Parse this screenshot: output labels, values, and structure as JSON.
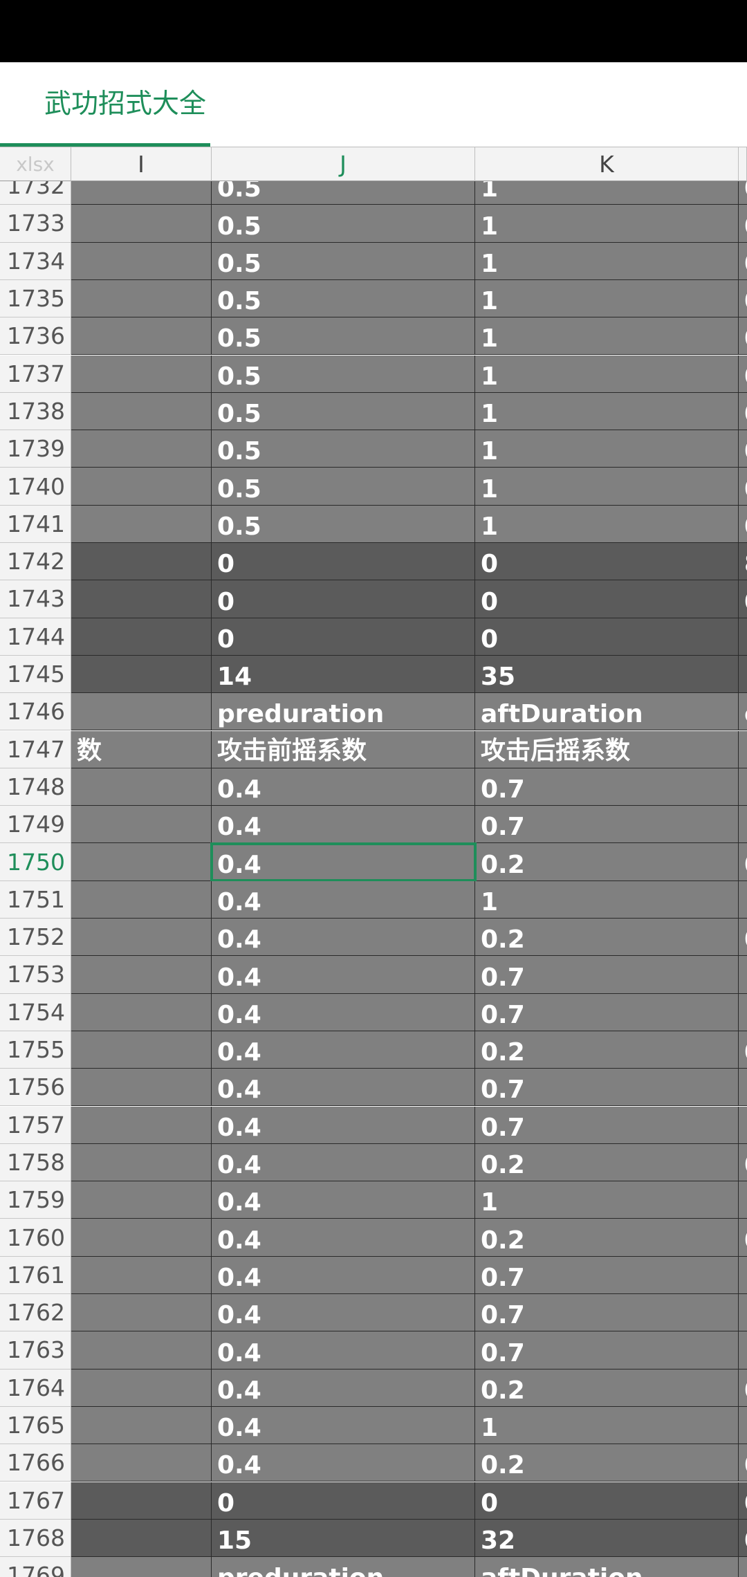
{
  "sheet_tab": {
    "label": "武功招式大全"
  },
  "columns": [
    {
      "label": "xlsx"
    },
    {
      "label": "I"
    },
    {
      "label": "J"
    },
    {
      "label": "K"
    },
    {
      "label": ""
    }
  ],
  "selected": {
    "row": "1750",
    "column": "J"
  },
  "rows": [
    {
      "num": "1732",
      "i": "",
      "j": "0.5",
      "k": "1",
      "l": "0",
      "style": "light"
    },
    {
      "num": "1733",
      "i": "",
      "j": "0.5",
      "k": "1",
      "l": "0",
      "style": "light"
    },
    {
      "num": "1734",
      "i": "",
      "j": "0.5",
      "k": "1",
      "l": "0",
      "style": "light"
    },
    {
      "num": "1735",
      "i": "",
      "j": "0.5",
      "k": "1",
      "l": "0",
      "style": "light"
    },
    {
      "num": "1736",
      "i": "",
      "j": "0.5",
      "k": "1",
      "l": "0",
      "style": "light"
    },
    {
      "num": "1737",
      "i": "",
      "j": "0.5",
      "k": "1",
      "l": "0",
      "style": "light"
    },
    {
      "num": "1738",
      "i": "",
      "j": "0.5",
      "k": "1",
      "l": "0",
      "style": "light"
    },
    {
      "num": "1739",
      "i": "",
      "j": "0.5",
      "k": "1",
      "l": "0",
      "style": "light"
    },
    {
      "num": "1740",
      "i": "",
      "j": "0.5",
      "k": "1",
      "l": "0",
      "style": "light"
    },
    {
      "num": "1741",
      "i": "",
      "j": "0.5",
      "k": "1",
      "l": "0",
      "style": "light"
    },
    {
      "num": "1742",
      "i": "",
      "j": "0",
      "k": "0",
      "l": "8",
      "style": "dark"
    },
    {
      "num": "1743",
      "i": "",
      "j": "0",
      "k": "0",
      "l": "0",
      "style": "dark"
    },
    {
      "num": "1744",
      "i": "",
      "j": "0",
      "k": "0",
      "l": "1",
      "style": "dark"
    },
    {
      "num": "1745",
      "i": "",
      "j": "14",
      "k": "35",
      "l": "",
      "style": "dark"
    },
    {
      "num": "1746",
      "i": "",
      "j": "preduration",
      "k": "aftDuration",
      "l": "c",
      "style": "light"
    },
    {
      "num": "1747",
      "i": "数",
      "j": "攻击前摇系数",
      "k": "攻击后摇系数",
      "l": "",
      "style": "light"
    },
    {
      "num": "1748",
      "i": "",
      "j": "0.4",
      "k": "0.7",
      "l": "",
      "style": "light"
    },
    {
      "num": "1749",
      "i": "",
      "j": "0.4",
      "k": "0.7",
      "l": "",
      "style": "light"
    },
    {
      "num": "1750",
      "i": "",
      "j": "0.4",
      "k": "0.2",
      "l": "0",
      "style": "light"
    },
    {
      "num": "1751",
      "i": "",
      "j": "0.4",
      "k": "1",
      "l": "",
      "style": "light"
    },
    {
      "num": "1752",
      "i": "",
      "j": "0.4",
      "k": "0.2",
      "l": "0",
      "style": "light"
    },
    {
      "num": "1753",
      "i": "",
      "j": "0.4",
      "k": "0.7",
      "l": "",
      "style": "light"
    },
    {
      "num": "1754",
      "i": "",
      "j": "0.4",
      "k": "0.7",
      "l": "",
      "style": "light"
    },
    {
      "num": "1755",
      "i": "",
      "j": "0.4",
      "k": "0.2",
      "l": "0",
      "style": "light"
    },
    {
      "num": "1756",
      "i": "",
      "j": "0.4",
      "k": "0.7",
      "l": "",
      "style": "light"
    },
    {
      "num": "1757",
      "i": "",
      "j": "0.4",
      "k": "0.7",
      "l": "",
      "style": "light"
    },
    {
      "num": "1758",
      "i": "",
      "j": "0.4",
      "k": "0.2",
      "l": "0",
      "style": "light"
    },
    {
      "num": "1759",
      "i": "",
      "j": "0.4",
      "k": "1",
      "l": "",
      "style": "light"
    },
    {
      "num": "1760",
      "i": "",
      "j": "0.4",
      "k": "0.2",
      "l": "0",
      "style": "light"
    },
    {
      "num": "1761",
      "i": "",
      "j": "0.4",
      "k": "0.7",
      "l": "",
      "style": "light"
    },
    {
      "num": "1762",
      "i": "",
      "j": "0.4",
      "k": "0.7",
      "l": "",
      "style": "light"
    },
    {
      "num": "1763",
      "i": "",
      "j": "0.4",
      "k": "0.7",
      "l": "",
      "style": "light"
    },
    {
      "num": "1764",
      "i": "",
      "j": "0.4",
      "k": "0.2",
      "l": "0",
      "style": "light"
    },
    {
      "num": "1765",
      "i": "",
      "j": "0.4",
      "k": "1",
      "l": "",
      "style": "light"
    },
    {
      "num": "1766",
      "i": "",
      "j": "0.4",
      "k": "0.2",
      "l": "0",
      "style": "light"
    },
    {
      "num": "1767",
      "i": "",
      "j": "0",
      "k": "0",
      "l": "0",
      "style": "dark"
    },
    {
      "num": "1768",
      "i": "",
      "j": "15",
      "k": "32",
      "l": "0",
      "style": "dark"
    },
    {
      "num": "1769",
      "i": "",
      "j": "preduration",
      "k": "aftDuration",
      "l": "",
      "style": "light"
    },
    {
      "num": "1770",
      "i": "数",
      "j": "攻击前摇系数",
      "k": "攻击后摇系数",
      "l": "",
      "style": "light"
    }
  ]
}
